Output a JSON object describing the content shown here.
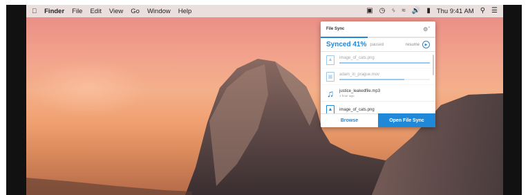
{
  "menubar": {
    "apple_icon": "apple-icon",
    "app_name": "Finder",
    "menus": [
      "File",
      "Edit",
      "View",
      "Go",
      "Window",
      "Help"
    ],
    "status_icons": [
      "file-sync-icon",
      "time-machine-icon",
      "bluetooth-icon",
      "wifi-icon",
      "volume-icon",
      "battery-icon"
    ],
    "clock": "Thu 9:41 AM",
    "right_icons": [
      "spotlight-icon",
      "notification-center-icon"
    ]
  },
  "popover": {
    "title": "File Sync",
    "settings_icon": "gear-icon",
    "overall_progress": 0.41,
    "synced_label": "Synced 41%",
    "paused_label": "paused",
    "resume_label": "resume",
    "files": [
      {
        "name": "image_of_cats.png",
        "subtitle": "",
        "icon": "image-file-icon",
        "progress": 1.0,
        "dimmed": true
      },
      {
        "name": "adam_in_prague.mov",
        "subtitle": "",
        "icon": "video-file-icon",
        "progress": 0.72,
        "dimmed": true
      },
      {
        "name": "justice_leakedfile.mp3",
        "subtitle": "1 hour ago",
        "icon": "music-file-icon",
        "progress": null,
        "dimmed": false
      },
      {
        "name": "image_of_cats.png",
        "subtitle": "",
        "icon": "image-file-icon",
        "progress": null,
        "dimmed": false
      }
    ],
    "browse_label": "Browse",
    "open_label": "Open File Sync"
  },
  "colors": {
    "accent": "#1f88d8",
    "menubar": "#ebebeb"
  }
}
